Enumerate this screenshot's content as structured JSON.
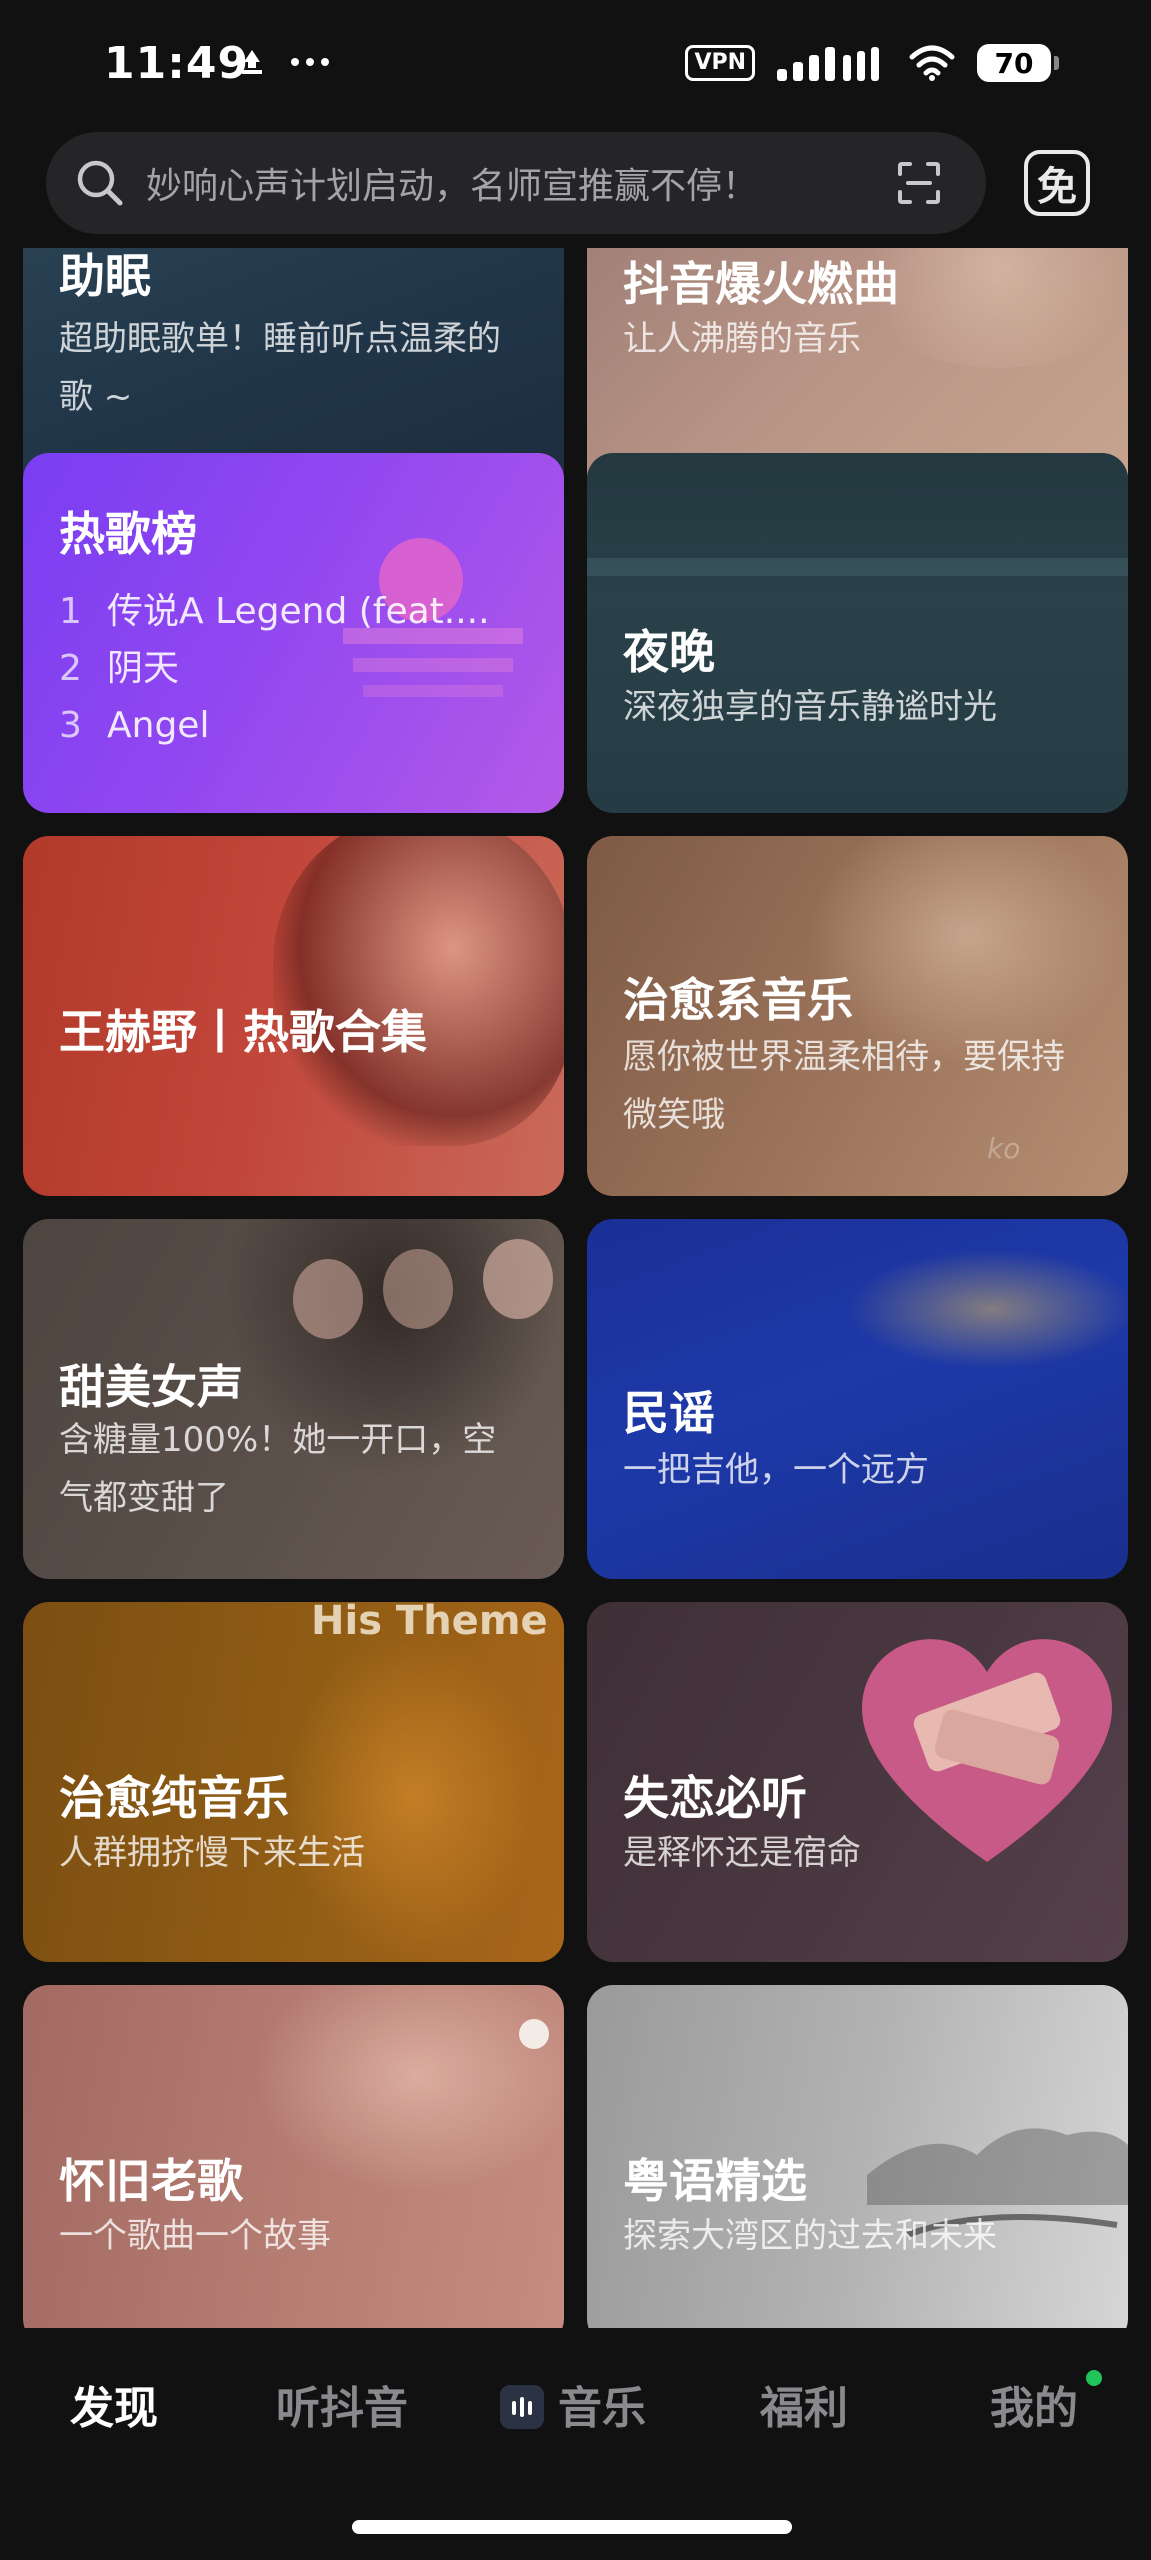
{
  "status_bar": {
    "time": "11:49",
    "vpn": "VPN",
    "battery": "70"
  },
  "search": {
    "placeholder": "妙响心声计划启动，名师宣推赢不停！",
    "free_label": "免"
  },
  "cards": [
    {
      "title": "助眠",
      "subtitle": "超助眠歌单！睡前听点温柔的歌 ~"
    },
    {
      "title": "抖音爆火燃曲",
      "subtitle": "让人沸腾的音乐"
    },
    {
      "title": "热歌榜",
      "ranks": [
        {
          "num": "1",
          "name": "传说A Legend (feat...."
        },
        {
          "num": "2",
          "name": "阴天"
        },
        {
          "num": "3",
          "name": "Angel"
        }
      ]
    },
    {
      "title": "夜晚",
      "subtitle": "深夜独享的音乐静谧时光"
    },
    {
      "title": "王赫野丨热歌合集"
    },
    {
      "title": "治愈系音乐",
      "subtitle": "愿你被世界温柔相待，要保持微笑哦",
      "overlay": "ko"
    },
    {
      "title": "甜美女声",
      "subtitle": "含糖量100%！她一开口，空气都变甜了"
    },
    {
      "title": "民谣",
      "subtitle": "一把吉他，一个远方"
    },
    {
      "title": "治愈纯音乐",
      "subtitle": "人群拥挤慢下来生活",
      "overlay": "His Theme"
    },
    {
      "title": "失恋必听",
      "subtitle": "是释怀还是宿命"
    },
    {
      "title": "怀旧老歌",
      "subtitle": "一个歌曲一个故事"
    },
    {
      "title": "粤语精选",
      "subtitle": "探索大湾区的过去和未来"
    }
  ],
  "nav": {
    "discover": "发现",
    "listen_douyin": "听抖音",
    "music": "音乐",
    "welfare": "福利",
    "mine": "我的"
  },
  "colors": {
    "background": "#111112",
    "hot_chart": "#8a3cf0",
    "nav_active": "#ffffff",
    "nav_inactive": "#8a8a8e",
    "notification_dot": "#21c45a"
  }
}
